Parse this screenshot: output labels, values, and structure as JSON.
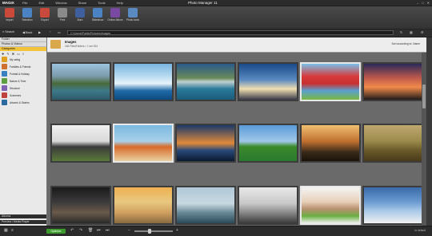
{
  "app": {
    "logo": "MAGIX",
    "title": "Photo Manager 11"
  },
  "menu": [
    "File",
    "Edit",
    "Window",
    "Share",
    "Tools",
    "Help"
  ],
  "toolbar": [
    {
      "label": "Import",
      "color": "#c94a3a",
      "icon": "import-icon"
    },
    {
      "label": "Selection",
      "color": "#4a82c2",
      "icon": "selection-icon"
    },
    {
      "label": "Export",
      "color": "#c94a3a",
      "icon": "export-icon"
    },
    {
      "label": "Print",
      "color": "#8a8a8a",
      "icon": "print-icon"
    },
    {
      "label": "Burn",
      "color": "#3f5f9f",
      "icon": "burn-icon"
    },
    {
      "label": "Slideshow",
      "color": "#4a82c2",
      "icon": "slideshow-icon"
    },
    {
      "label": "Online Album",
      "color": "#7a4aa2",
      "icon": "online-album-icon"
    },
    {
      "label": "Photo book",
      "color": "#5a8ac2",
      "icon": "photo-book-icon"
    }
  ],
  "nav": {
    "search": "Search",
    "back": "Back",
    "path": "C:\\Users\\Public\\Pictures\\Images"
  },
  "sidebar": {
    "header": "Folder",
    "section": "Photos & Videos",
    "active": "Categories",
    "items": [
      {
        "label": "My rating",
        "color": "#e0a020"
      },
      {
        "label": "Families & Friends",
        "color": "#d07030"
      },
      {
        "label": "Portrait & Holiday",
        "color": "#3a80c0"
      },
      {
        "label": "Nature & Time",
        "color": "#5aa040"
      },
      {
        "label": "Structure",
        "color": "#8060b0"
      },
      {
        "label": "Sceneries",
        "color": "#c04040"
      },
      {
        "label": "Artwork & Stories",
        "color": "#2a6aa0"
      }
    ],
    "albums": "Albums",
    "preview": "Preview / Media Player"
  },
  "info": {
    "title": "Images",
    "subtitle": "184 Files/Folders   ≈ 1 sm 024",
    "sort": "Sort according to: Name"
  },
  "thumbnails": [
    {
      "name": "mountain-lake-canoe",
      "bg": "linear-gradient(#9cc3e0 0%,#7a9aa8 35%,#4a6a3a 55%,#3f7a8a 75%,#2b5a6a 100%)",
      "selected": false
    },
    {
      "name": "glacier-ice",
      "bg": "linear-gradient(#7ab4e0 0%,#b8dcf0 35%,#e8f4fb 55%,#1f6aa8 75%,#0e4a80 100%)",
      "selected": false
    },
    {
      "name": "mountain-reflection",
      "bg": "linear-gradient(#2a5a8a 0%,#6a8a5a 40%,#c0d0d0 50%,#2a7a9a 70%,#1b5b7b 100%)",
      "selected": false
    },
    {
      "name": "sunrise-sky",
      "bg": "linear-gradient(#1a4a8a 0%,#5a8ac0 45%,#f0e0b0 70%,#3a3a4a 100%)",
      "selected": false
    },
    {
      "name": "girl-red-balloons",
      "bg": "linear-gradient(#7ac0e8 0%,#d83a3a 35%,#c83030 55%,#5aa0d0 75%,#7ab840 100%)",
      "selected": true
    },
    {
      "name": "sunset-silhouettes",
      "bg": "linear-gradient(#2a2a5a 0%,#c05a4a 40%,#f08a4a 65%,#201a1a 100%)",
      "selected": false
    },
    {
      "name": "bench-under-tree",
      "bg": "linear-gradient(#f0f0f0 0%,#d8d8d8 45%,#3a3a3a 60%,#5a7a3a 100%)",
      "selected": false
    },
    {
      "name": "orange-suitcase-beach",
      "bg": "linear-gradient(#7ab8e0 0%,#a8d0e8 45%,#d86a2a 60%,#e8d0a0 100%)",
      "selected": true
    },
    {
      "name": "palm-tree-sunset",
      "bg": "linear-gradient(#1a3a6a 0%,#e08a3a 50%,#2a4a7a 70%,#0a1a30 100%)",
      "selected": false
    },
    {
      "name": "windmill-field",
      "bg": "linear-gradient(#5a9ad8 0%,#a0c8e8 45%,#3a8a2a 60%,#2a7a30 100%)",
      "selected": false
    },
    {
      "name": "horse-rider-sunset",
      "bg": "linear-gradient(#f0c070 0%,#c07030 45%,#3a2a1a 75%,#1a1208 100%)",
      "selected": false
    },
    {
      "name": "woman-in-field",
      "bg": "linear-gradient(#c0a870 0%,#9a8a4a 45%,#6a5a2a 70%,#4a3a1a 100%)",
      "selected": false
    },
    {
      "name": "person-city-dark",
      "bg": "linear-gradient(#1a1a1a 0%,#3a3a3a 40%,#6a5a4a 70%,#2a2a2a 100%)",
      "selected": false
    },
    {
      "name": "pier-arch-sunset",
      "bg": "linear-gradient(#f0b050 0%,#e8c880 40%,#d0a060 70%,#8a6a40 100%)",
      "selected": false
    },
    {
      "name": "swimmer-sea",
      "bg": "linear-gradient(#b0c8d8 0%,#c8d8e0 45%,#6a8a98 70%,#2a4a5a 100%)",
      "selected": false
    },
    {
      "name": "man-umbrella",
      "bg": "linear-gradient(#e8e8e8 0%,#c8c8c8 45%,#8a8a8a 70%,#3a3a3a 100%)",
      "selected": false
    },
    {
      "name": "woman-green-apple",
      "bg": "linear-gradient(#f4f4f4 0%,#e8d0b8 40%,#b89070 60%,#6ab040 80%,#f0f0f0 100%)",
      "selected": true
    },
    {
      "name": "boy-raised-arms",
      "bg": "linear-gradient(#3a6aa8 0%,#6a9ad0 40%,#a8c8e8 65%,#f0f0f0 100%)",
      "selected": false
    }
  ],
  "status": {
    "optimize": "Optimize",
    "zoom_minus": "−",
    "zoom_plus": "+",
    "right": "to default"
  }
}
